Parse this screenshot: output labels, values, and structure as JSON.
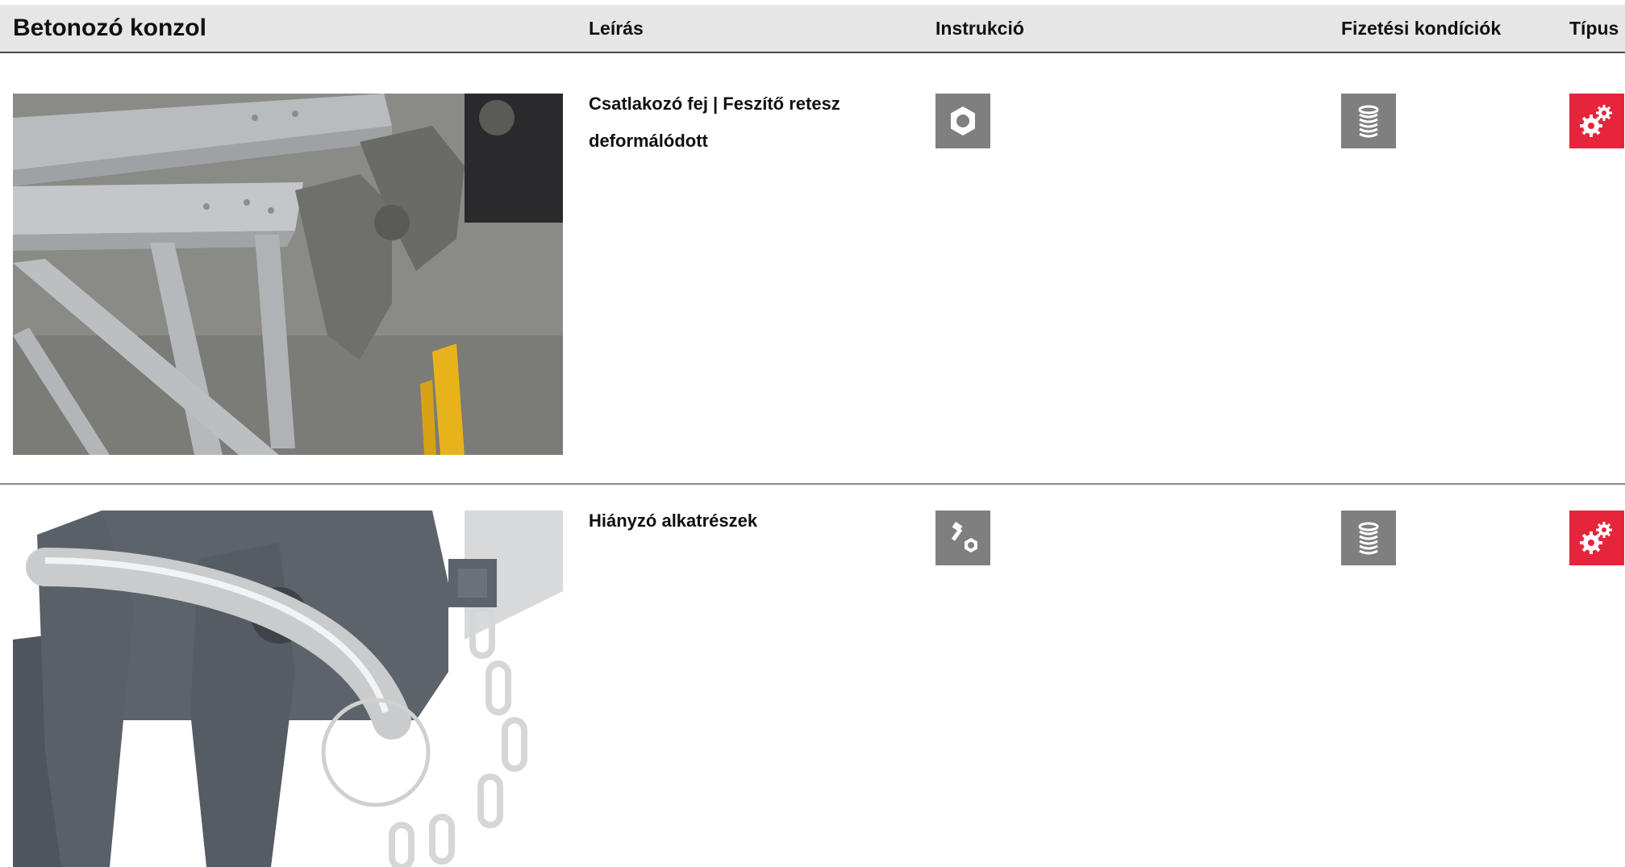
{
  "header": {
    "title": "Betonozó konzol",
    "col_description": "Leírás",
    "col_instruction": "Instrukció",
    "col_payment": "Fizetési kondíciók",
    "col_type": "Típus"
  },
  "rows": [
    {
      "description_line1": "Csatlakozó fej | Feszítő retesz",
      "description_line2": "deformálódott",
      "instruction_icon": "nut-icon",
      "payment_icon": "coin-stack-icon",
      "type_icon": "gears-icon"
    },
    {
      "description_line1": "Hiányzó alkatrészek",
      "instruction_icon": "bolt-nut-icon",
      "payment_icon": "coin-stack-icon",
      "type_icon": "gears-icon"
    }
  ],
  "colors": {
    "header_bg": "#e6e6e6",
    "icon_grey": "#7f7f7f",
    "icon_red": "#e4253b"
  }
}
